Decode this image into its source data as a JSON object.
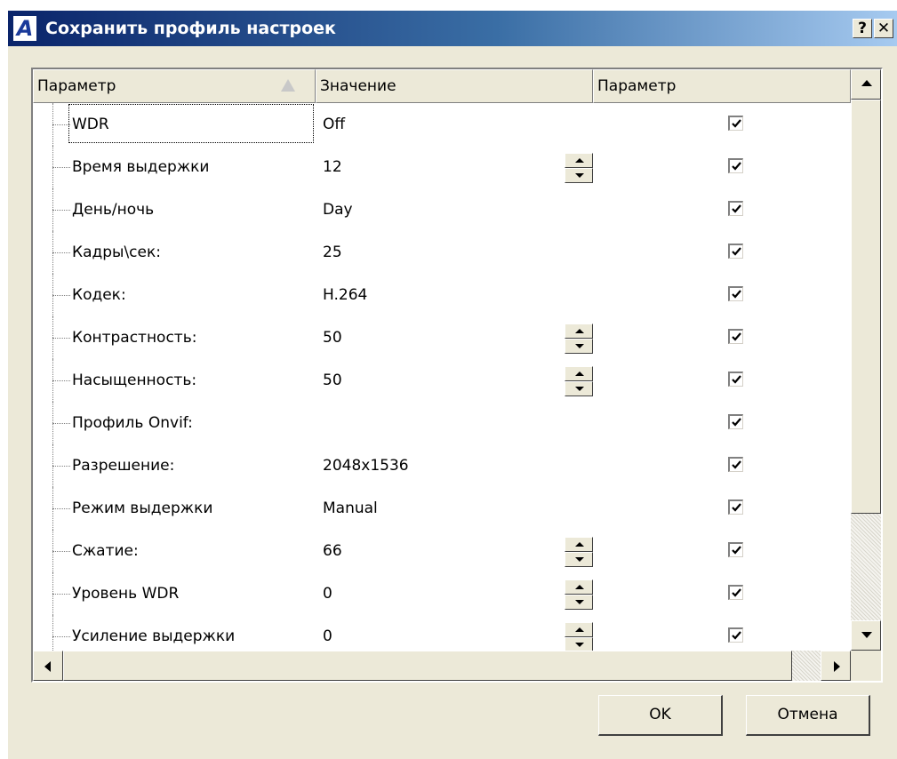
{
  "window": {
    "title": "Сохранить профиль настроек",
    "icon_letter": "A",
    "help_label": "?",
    "close_label": "✕"
  },
  "grid": {
    "columns": [
      "Параметр",
      "Значение",
      "Параметр"
    ],
    "sorted_column": 0,
    "rows": [
      {
        "name": "WDR",
        "value": "Off",
        "spinner": false,
        "checked": true,
        "focused": true
      },
      {
        "name": "Время выдержки",
        "value": "12",
        "spinner": true,
        "checked": true
      },
      {
        "name": "День/ночь",
        "value": "Day",
        "spinner": false,
        "checked": true
      },
      {
        "name": "Кадры\\сек:",
        "value": "25",
        "spinner": false,
        "checked": true
      },
      {
        "name": "Кодек:",
        "value": "H.264",
        "spinner": false,
        "checked": true
      },
      {
        "name": "Контрастность:",
        "value": "50",
        "spinner": true,
        "checked": true
      },
      {
        "name": "Насыщенность:",
        "value": "50",
        "spinner": true,
        "checked": true
      },
      {
        "name": "Профиль Onvif:",
        "value": "",
        "spinner": false,
        "checked": true
      },
      {
        "name": "Разрешение:",
        "value": "2048x1536",
        "spinner": false,
        "checked": true
      },
      {
        "name": "Режим выдержки",
        "value": "Manual",
        "spinner": false,
        "checked": true
      },
      {
        "name": "Сжатие:",
        "value": "66",
        "spinner": true,
        "checked": true
      },
      {
        "name": "Уровень WDR",
        "value": "0",
        "spinner": true,
        "checked": true
      },
      {
        "name": "Усиление выдержки",
        "value": "0",
        "spinner": true,
        "checked": true
      }
    ]
  },
  "buttons": {
    "ok": "OK",
    "cancel": "Отмена"
  },
  "colors": {
    "titlebar_start": "#0a246a",
    "titlebar_end": "#a6caf0",
    "face": "#ece9d8"
  }
}
